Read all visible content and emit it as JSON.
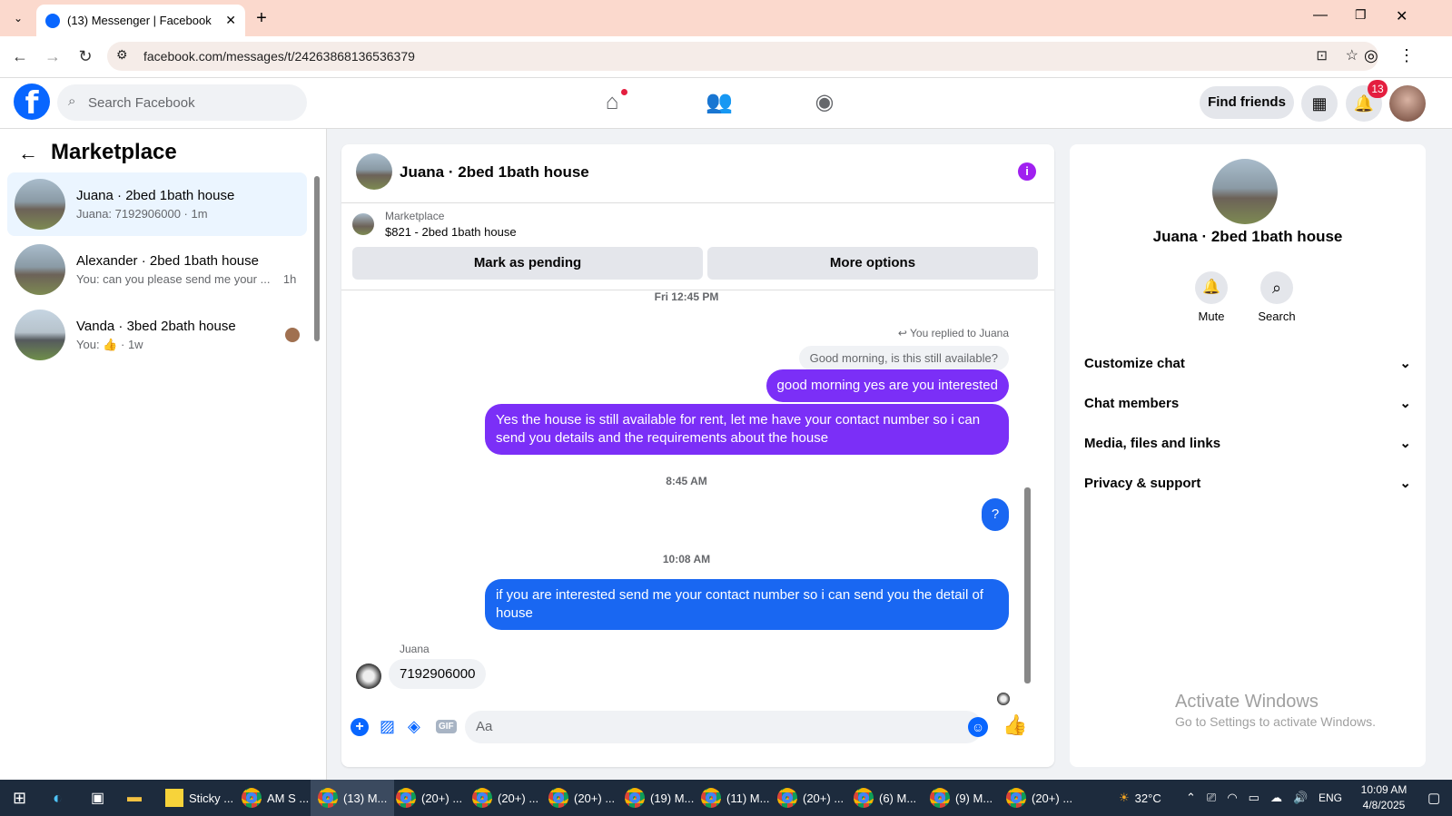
{
  "browser": {
    "tab_title": "(13) Messenger | Facebook",
    "url": "facebook.com/messages/t/24263868136536379"
  },
  "fb": {
    "search_placeholder": "Search Facebook",
    "find_friends": "Find friends",
    "notif_count": "13"
  },
  "left": {
    "heading": "Marketplace",
    "conversations": [
      {
        "title": "Juana · 2bed 1bath house",
        "sub": "Juana: 7192906000 · 1m"
      },
      {
        "title": "Alexander · 2bed 1bath house",
        "sub": "You: can you please send me your ...",
        "time": "1h"
      },
      {
        "title": "Vanda · 3bed 2bath house",
        "sub": "You:",
        "time": "1w"
      }
    ]
  },
  "chat": {
    "title": "Juana · 2bed 1bath house",
    "listing_source": "Marketplace",
    "listing": "$821 - 2bed 1bath house",
    "mark_pending": "Mark as pending",
    "more_options": "More options",
    "ts1": "Fri 12:45 PM",
    "replied_to": "You replied to Juana",
    "quoted": "Good morning, is this still available?",
    "msg1": "good morning yes are you interested",
    "msg2": "Yes the house is still available for rent, let me have your contact number so i can send you details and the requirements about the house",
    "ts2": "8:45 AM",
    "msg3": "?",
    "ts3": "10:08 AM",
    "msg4": "if you are interested send me your contact number  so i can send you the detail of house",
    "sender": "Juana",
    "reply": "7192906000",
    "input_placeholder": "Aa",
    "gif": "GIF"
  },
  "right": {
    "name": "Juana · 2bed 1bath house",
    "mute": "Mute",
    "search": "Search",
    "rows": [
      "Customize chat",
      "Chat members",
      "Media, files and links",
      "Privacy & support"
    ],
    "watermark_title": "Activate Windows",
    "watermark_sub": "Go to Settings to activate Windows."
  },
  "taskbar": {
    "items": [
      "Sticky ...",
      "AM S ...",
      "(13) M...",
      "(20+) ...",
      "(20+) ...",
      "(20+) ...",
      "(19) M...",
      "(11) M...",
      "(20+) ...",
      "(6) M...",
      "(9) M...",
      "(20+) ..."
    ],
    "temp": "32°C",
    "lang": "ENG",
    "time": "10:09 AM",
    "date": "4/8/2025"
  },
  "colors": {
    "brand": "#0866ff",
    "purple_bubble": "#7b2ff7",
    "blue_bubble": "#1967f2"
  }
}
